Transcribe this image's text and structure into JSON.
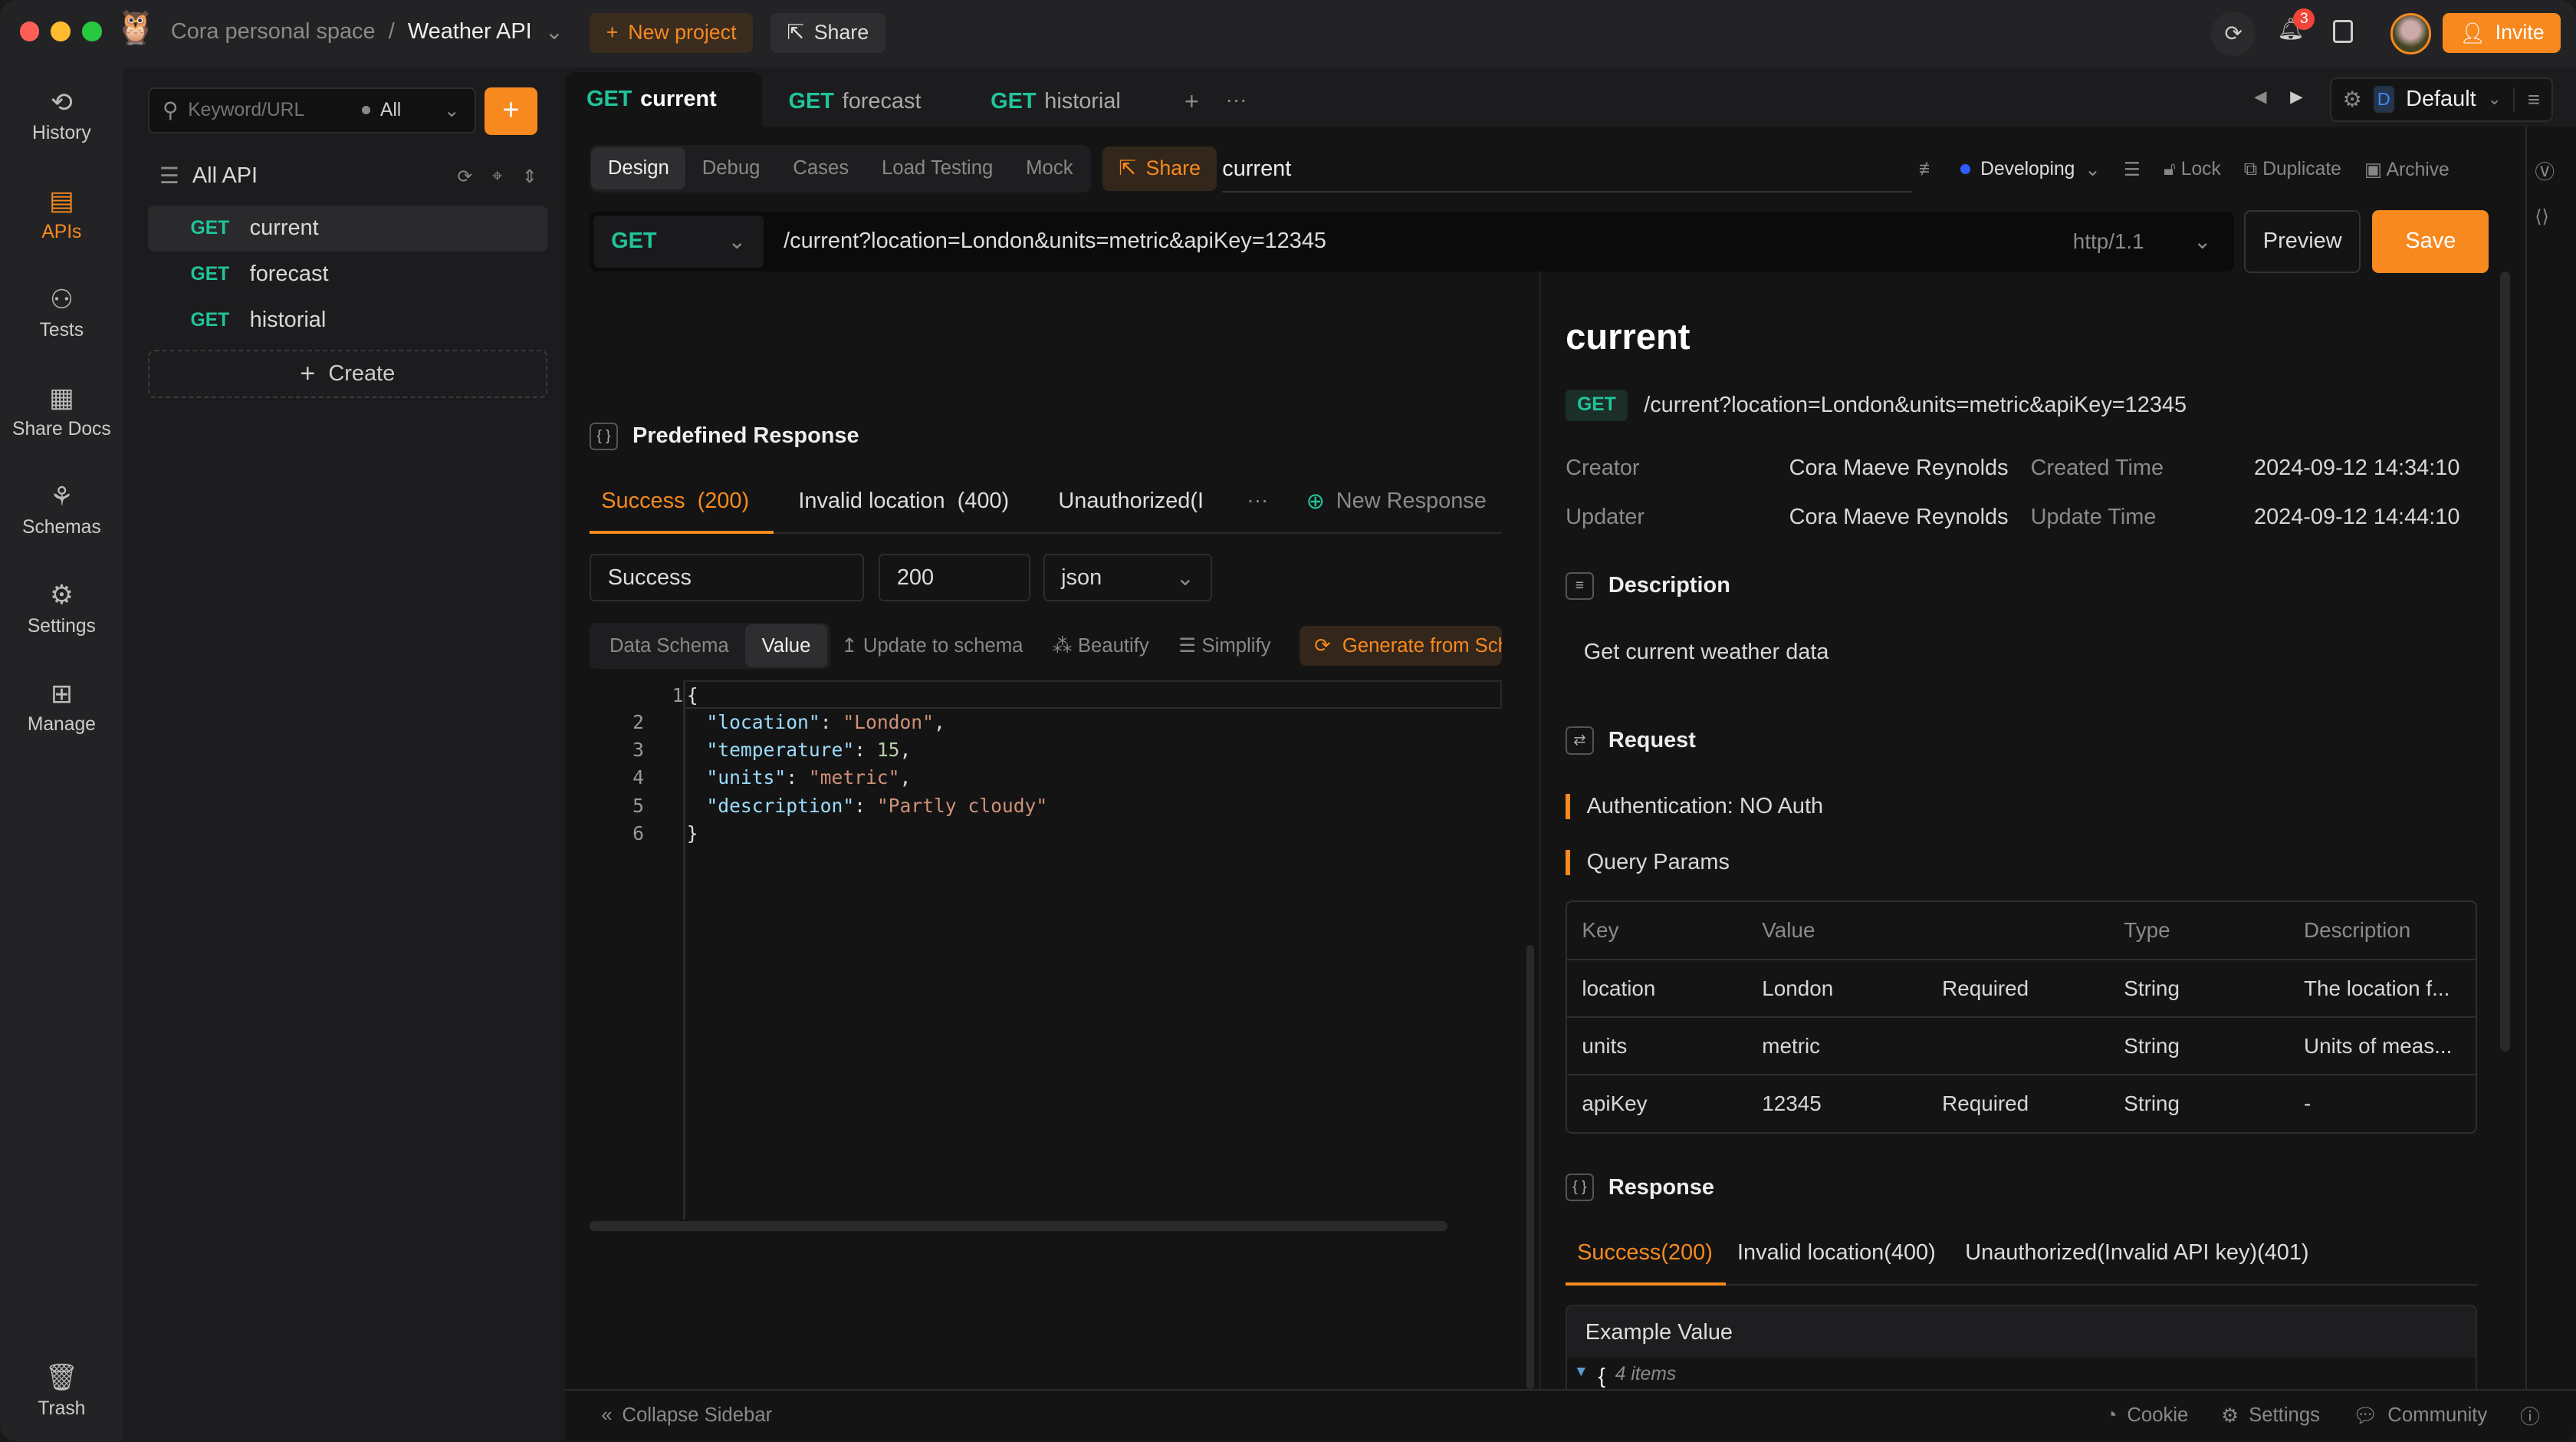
{
  "colors": {
    "accent": "#f7891f",
    "get_method": "#21c49a",
    "status_developing": "#2f5cff"
  },
  "titlebar": {
    "workspace": "Cora personal space",
    "project": "Weather API",
    "new_project": "New project",
    "share": "Share",
    "notifications_count": "3",
    "invite": "Invite"
  },
  "nav": [
    {
      "label": "History",
      "icon": "history-icon"
    },
    {
      "label": "APIs",
      "icon": "apis-icon"
    },
    {
      "label": "Tests",
      "icon": "tests-icon"
    },
    {
      "label": "Share Docs",
      "icon": "share-docs-icon"
    },
    {
      "label": "Schemas",
      "icon": "schemas-icon"
    },
    {
      "label": "Settings",
      "icon": "settings-icon"
    },
    {
      "label": "Manage",
      "icon": "manage-icon"
    }
  ],
  "trash": "Trash",
  "tree": {
    "search_placeholder": "Keyword/URL",
    "filter": "All",
    "root": "All API",
    "items": [
      {
        "method": "GET",
        "name": "current"
      },
      {
        "method": "GET",
        "name": "forecast"
      },
      {
        "method": "GET",
        "name": "historial"
      }
    ],
    "create": "Create"
  },
  "tabs": [
    {
      "method": "GET",
      "name": "current"
    },
    {
      "method": "GET",
      "name": "forecast"
    },
    {
      "method": "GET",
      "name": "historial"
    }
  ],
  "environment": "Default",
  "environment_badge": "D",
  "subtabs": [
    "Design",
    "Debug",
    "Cases",
    "Load Testing",
    "Mock"
  ],
  "share": "Share",
  "api_name": "current",
  "status": "Developing",
  "actions": {
    "lock": "Lock",
    "duplicate": "Duplicate",
    "archive": "Archive"
  },
  "request": {
    "method": "GET",
    "url": "/current?location=London&units=metric&apiKey=12345",
    "protocol": "http/1.1",
    "preview": "Preview",
    "save": "Save"
  },
  "predefined": {
    "title": "Predefined Response",
    "tabs": [
      "Success  (200)",
      "Invalid location  (400)",
      "Unauthorized(I"
    ],
    "new_response": "New Response",
    "name": "Success",
    "code": "200",
    "format": "json",
    "modes": [
      "Data Schema",
      "Value"
    ],
    "tools": [
      "Update to schema",
      "Beautify",
      "Simplify",
      "Generate from Sch"
    ],
    "lines": [
      [
        "{"
      ],
      [
        "\"location\"",
        ": ",
        "\"London\"",
        ","
      ],
      [
        "\"temperature\"",
        ": ",
        "15",
        ","
      ],
      [
        "\"units\"",
        ": ",
        "\"metric\"",
        ","
      ],
      [
        "\"description\"",
        ": ",
        "\"Partly cloudy\"",
        ""
      ],
      [
        "}"
      ]
    ]
  },
  "doc": {
    "title": "current",
    "method": "GET",
    "url": "/current?location=London&units=metric&apiKey=12345",
    "creator_label": "Creator",
    "creator": "Cora Maeve Reynolds",
    "created_label": "Created Time",
    "created": "2024-09-12 14:34:10",
    "updater_label": "Updater",
    "updater": "Cora Maeve Reynolds",
    "updated_label": "Update Time",
    "updated": "2024-09-12 14:44:10",
    "description_title": "Description",
    "description": "Get current weather data",
    "request_title": "Request",
    "auth": "Authentication: NO Auth",
    "query_title": "Query Params",
    "columns": [
      "Key",
      "Value",
      "",
      "Type",
      "Description"
    ],
    "params": [
      [
        "location",
        "London",
        "Required",
        "String",
        "The location f..."
      ],
      [
        "units",
        "metric",
        "",
        "String",
        "Units of meas..."
      ],
      [
        "apiKey",
        "12345",
        "Required",
        "String",
        "-"
      ]
    ],
    "response_title": "Response",
    "response_tabs": [
      "Success(200)",
      "Invalid location(400)",
      "Unauthorized(Invalid API key)(401)"
    ],
    "example_title": "Example Value",
    "example_items": "4 items"
  },
  "footer": {
    "collapse": "Collapse Sidebar",
    "cookie": "Cookie",
    "settings": "Settings",
    "community": "Community"
  }
}
